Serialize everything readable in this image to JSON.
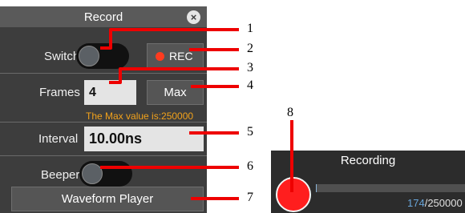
{
  "record_panel": {
    "title": "Record",
    "close_glyph": "×",
    "switch": {
      "label": "Switch",
      "on": false
    },
    "rec_button": {
      "label": "REC"
    },
    "frames": {
      "label": "Frames",
      "value": "4"
    },
    "max_button": {
      "label": "Max"
    },
    "max_hint": "The Max value is:250000",
    "interval": {
      "label": "Interval",
      "value": "10.00ns"
    },
    "beeper": {
      "label": "Beeper",
      "on": false
    },
    "waveform_button": {
      "label": "Waveform Player"
    }
  },
  "recording_panel": {
    "title": "Recording",
    "current": "174",
    "total": "/250000",
    "progress_fraction": 0.0007
  },
  "callouts": [
    "1",
    "2",
    "3",
    "4",
    "5",
    "6",
    "7",
    "8"
  ],
  "colors": {
    "callout_line": "#ee0000",
    "hint": "#f2a21b",
    "rec_red": "#ff1e1e"
  }
}
